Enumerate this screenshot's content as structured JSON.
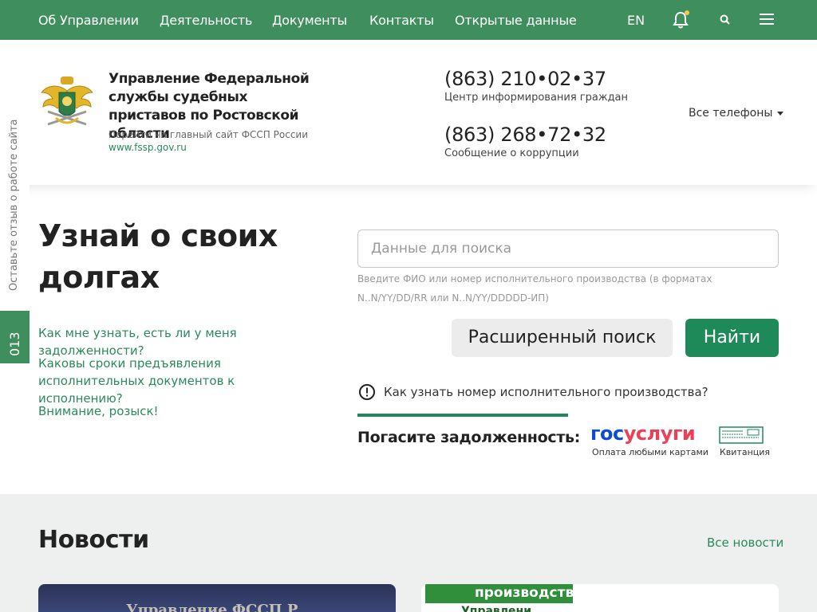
{
  "nav": {
    "items": [
      "Об Управлении",
      "Деятельность",
      "Документы",
      "Контакты",
      "Открытые данные"
    ],
    "lang": "EN"
  },
  "header": {
    "org_title": "Управление Федеральной службы судебных приставов по Ростовской области",
    "goto_main": "Перейти на главный сайт ФССП России",
    "main_link": "www.fssp.gov.ru",
    "phone1": "(863) 210•02•37",
    "phone1_caption": "Центр информирования граждан",
    "phone2": "(863) 268•72•32",
    "phone2_caption": "Сообщение о коррупции",
    "all_phones": "Все телефоны"
  },
  "side": {
    "feedback": "Оставьте отзыв о работе сайта",
    "code": "013"
  },
  "debt": {
    "title": "Узнай о своих долгах",
    "faq": [
      "Как мне узнать, есть ли у меня задолженности?",
      "Каковы сроки предъявления исполнительных документов к исполнению?",
      "Внимание, розыск!"
    ],
    "search_placeholder": "Данные для поиска",
    "search_hint": "Введите ФИО или номер исполнительного производства (в форматах N..N/YY/DD/RR или N..N/YY/DDDDD-ИП)",
    "advanced_button": "Расширенный поиск",
    "find_button": "Найти",
    "info_link": "Как узнать номер исполнительного производства?",
    "pay_label": "Погасите задолженность:",
    "gosuslugi_gos": "гос",
    "gosuslugi_usl": "услуги",
    "gosuslugi_caption": "Оплата любыми картами",
    "receipt_caption": "Квитанция"
  },
  "news": {
    "title": "Новости",
    "all_link": "Все новости",
    "card1_caption": "Управление ФССП Р...",
    "card2_band": "производств",
    "card2_sub": "Управлени..."
  },
  "colors": {
    "brand_green": "#3f8f5e",
    "button_green": "#1e8a5a",
    "link_green": "#2a8a5c",
    "gosuslugi_blue": "#0d4cd3",
    "gosuslugi_red": "#ee3f58"
  }
}
